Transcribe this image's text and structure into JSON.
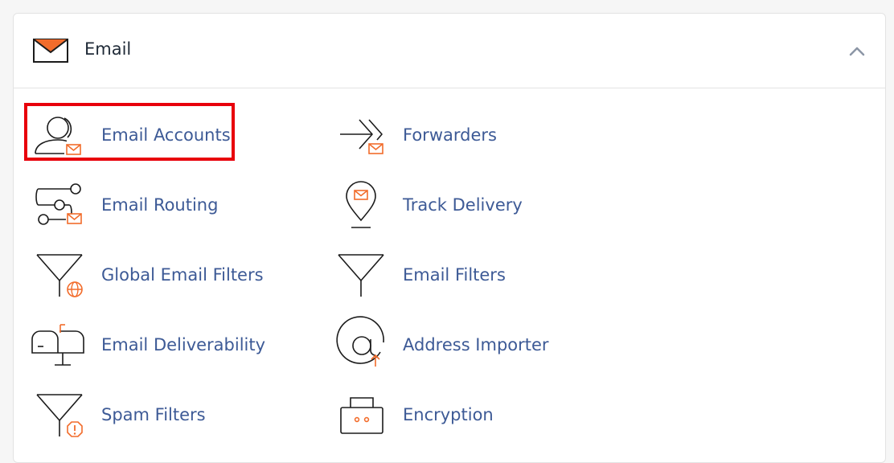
{
  "section": {
    "title": "Email",
    "icon": "envelope-icon",
    "toggle_icon": "chevron-up-icon"
  },
  "items": [
    {
      "label": "Email Accounts",
      "icon": "user-mail-icon",
      "highlighted": true
    },
    {
      "label": "Forwarders",
      "icon": "forward-mail-icon"
    },
    {
      "label": "Email Routing",
      "icon": "routing-icon"
    },
    {
      "label": "Track Delivery",
      "icon": "location-pin-mail-icon"
    },
    {
      "label": "Global Email Filters",
      "icon": "funnel-globe-icon"
    },
    {
      "label": "Email Filters",
      "icon": "funnel-icon"
    },
    {
      "label": "Email Deliverability",
      "icon": "mailbox-icon"
    },
    {
      "label": "Address Importer",
      "icon": "at-sign-upload-icon"
    },
    {
      "label": "Spam Filters",
      "icon": "funnel-warning-icon"
    },
    {
      "label": "Encryption",
      "icon": "lock-box-icon"
    }
  ],
  "colors": {
    "accent": "#f26c2b",
    "label": "#3d5a96",
    "highlight": "#e8000b",
    "icon_stroke": "#1b1b1b"
  }
}
